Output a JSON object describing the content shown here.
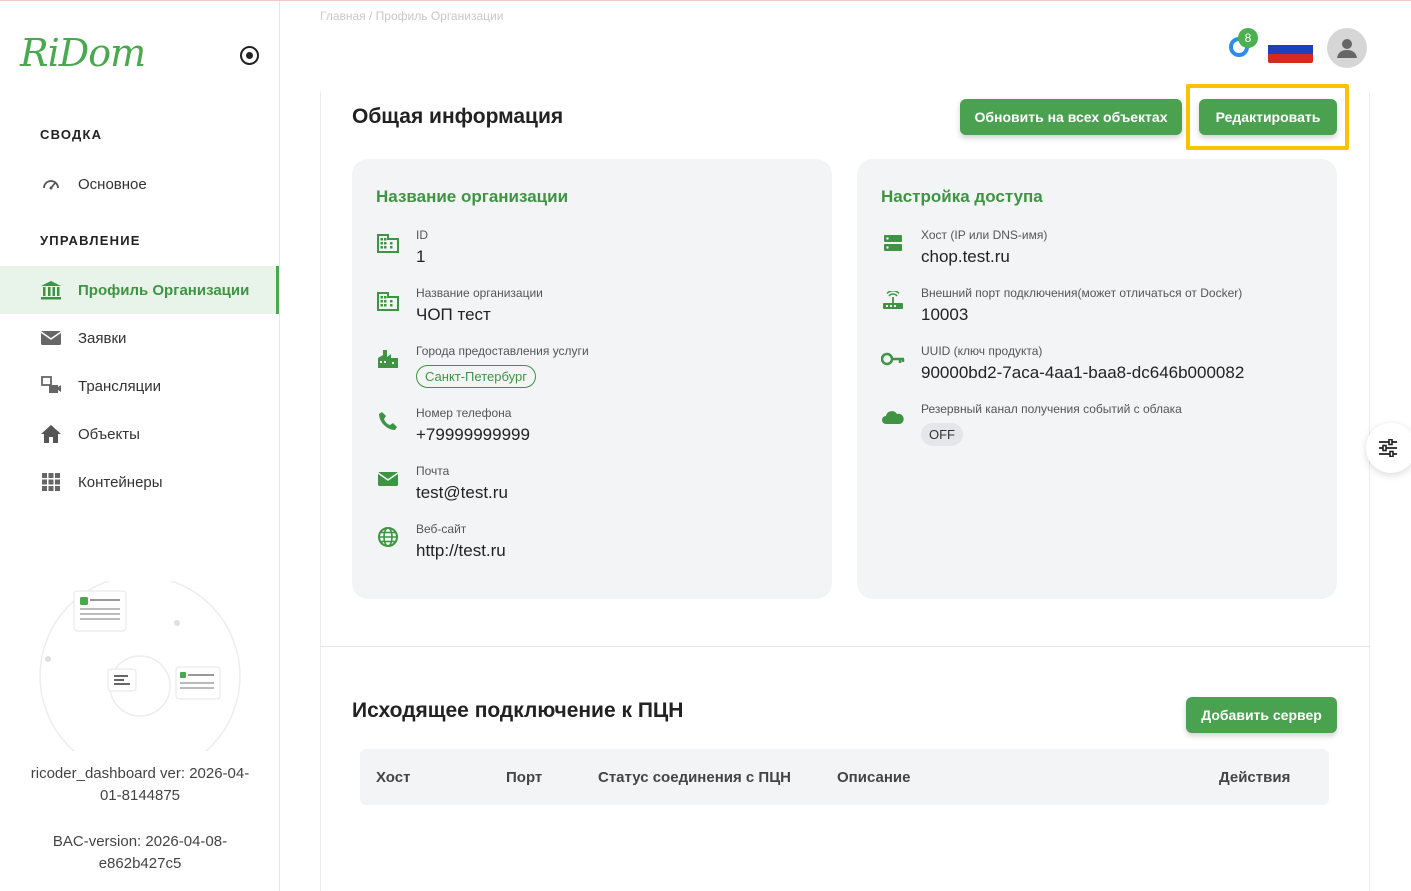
{
  "brand": {
    "logo": "RiDom"
  },
  "sidebar": {
    "section_summary": "СВОДКА",
    "section_manage": "УПРАВЛЕНИЕ",
    "items": [
      {
        "label": "Основное",
        "icon": "speedometer-icon"
      },
      {
        "label": "Профиль Организации",
        "icon": "bank-icon",
        "active": true
      },
      {
        "label": "Заявки",
        "icon": "mail-icon"
      },
      {
        "label": "Трансляции",
        "icon": "cameras-icon"
      },
      {
        "label": "Объекты",
        "icon": "home-icon"
      },
      {
        "label": "Контейнеры",
        "icon": "grid-icon"
      }
    ],
    "version_dashboard": "ricoder_dashboard ver: 2026-04-01-8144875",
    "version_bac": "BAC-version: 2026-04-08-e862b427c5"
  },
  "header": {
    "notifications_count": "8",
    "language": "RU",
    "breadcrumb_faded": "Главная   /   Профиль Организации"
  },
  "general": {
    "title": "Общая информация",
    "update_all_label": "Обновить на всех объектах",
    "edit_label": "Редактировать"
  },
  "org_panel": {
    "title": "Название организации",
    "fields": [
      {
        "label": "ID",
        "value": "1"
      },
      {
        "label": "Название организации",
        "value": "ЧОП тест"
      },
      {
        "label": "Города предоставления услуги",
        "value": "Санкт-Петербург"
      },
      {
        "label": "Номер телефона",
        "value": "+79999999999"
      },
      {
        "label": "Почта",
        "value": "test@test.ru"
      },
      {
        "label": "Веб-сайт",
        "value": "http://test.ru"
      }
    ]
  },
  "access_panel": {
    "title": "Настройка доступа",
    "fields": [
      {
        "label": "Хост (IP или DNS-имя)",
        "value": "chop.test.ru"
      },
      {
        "label": "Внешний порт подключения(может отличаться от Docker)",
        "value": "10003"
      },
      {
        "label": "UUID (ключ продукта)",
        "value": "90000bd2-7aca-4aa1-baa8-dc646b000082"
      },
      {
        "label": "Резервный канал получения событий с облака",
        "value": "OFF"
      }
    ]
  },
  "outgoing": {
    "title": "Исходящее подключение к ПЦН",
    "add_server_label": "Добавить сервер",
    "columns": [
      "Хост",
      "Порт",
      "Статус соединения с ПЦН",
      "Описание",
      "Действия"
    ]
  },
  "colors": {
    "accent": "#4aa150",
    "accent_text": "#3e9443",
    "highlight": "#f7c200"
  }
}
